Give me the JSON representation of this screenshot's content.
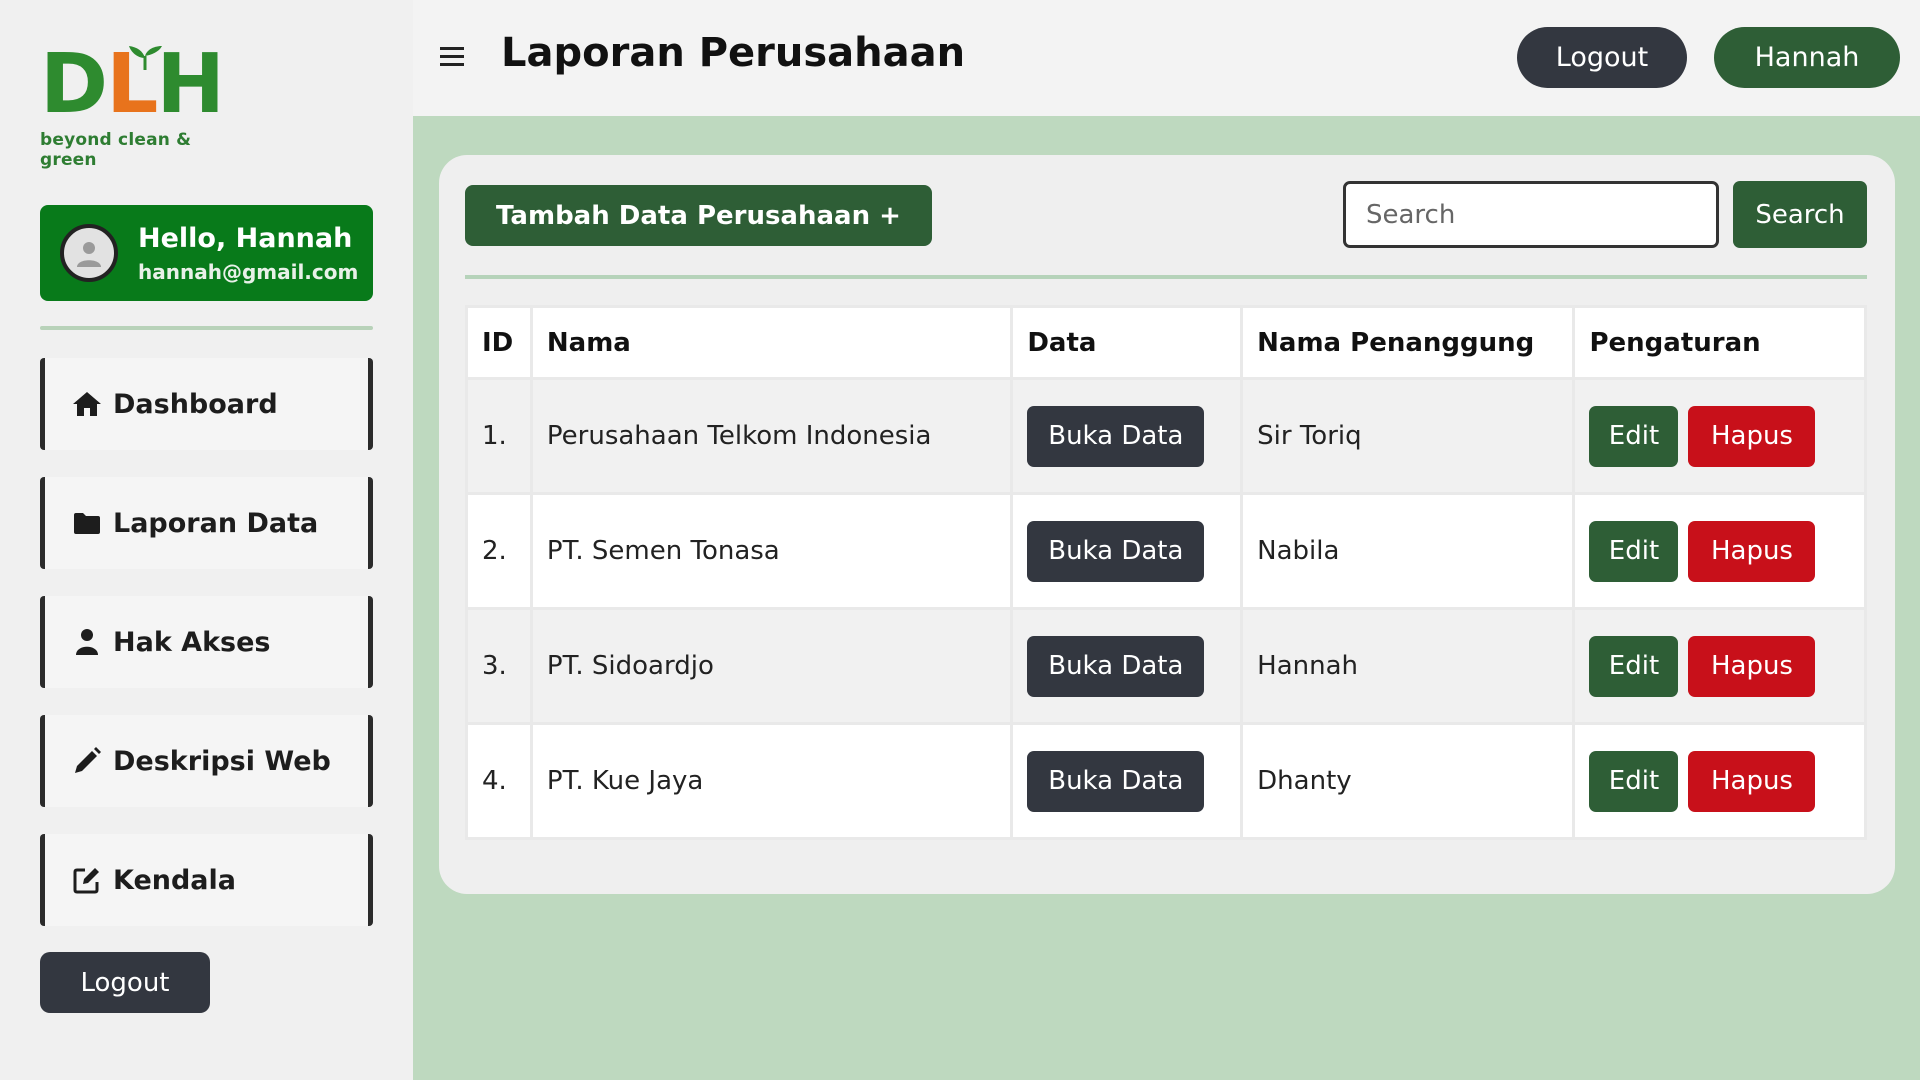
{
  "logo": {
    "text_part1": "D",
    "text_mid": "L",
    "text_part2": "H",
    "tagline": "beyond clean & green"
  },
  "profile": {
    "greeting": "Hello, Hannah",
    "email": "hannah@gmail.com"
  },
  "sidebar": {
    "items": [
      {
        "label": "Dashboard",
        "icon": "home-icon"
      },
      {
        "label": "Laporan Data",
        "icon": "folder-icon"
      },
      {
        "label": "Hak Akses",
        "icon": "user-icon"
      },
      {
        "label": "Deskripsi Web",
        "icon": "pencil-icon"
      },
      {
        "label": "Kendala",
        "icon": "edit-square-icon"
      }
    ],
    "logout_label": "Logout"
  },
  "header": {
    "title": "Laporan Perusahaan",
    "logout_label": "Logout",
    "user_label": "Hannah"
  },
  "toolbar": {
    "add_label": "Tambah Data Perusahaan +",
    "search_placeholder": "Search",
    "search_button": "Search"
  },
  "table": {
    "headers": [
      "ID",
      "Nama",
      "Data",
      "Nama Penanggung",
      "Pengaturan"
    ],
    "rows": [
      {
        "id": "1.",
        "nama": "Perusahaan Telkom Indonesia",
        "data_button": "Buka Data",
        "penanggung": "Sir Toriq",
        "edit": "Edit",
        "hapus": "Hapus"
      },
      {
        "id": "2.",
        "nama": "PT. Semen Tonasa",
        "data_button": "Buka Data",
        "penanggung": "Nabila",
        "edit": "Edit",
        "hapus": "Hapus"
      },
      {
        "id": "3.",
        "nama": "PT. Sidoardjo",
        "data_button": "Buka Data",
        "penanggung": "Hannah",
        "edit": "Edit",
        "hapus": "Hapus"
      },
      {
        "id": "4.",
        "nama": "PT. Kue Jaya",
        "data_button": "Buka Data",
        "penanggung": "Dhanty",
        "edit": "Edit",
        "hapus": "Hapus"
      }
    ]
  },
  "colors": {
    "primary_green": "#2e5e36",
    "profile_green": "#087a1a",
    "danger_red": "#c8101a",
    "dark_button": "#333740",
    "content_bg": "#bed9bf"
  }
}
